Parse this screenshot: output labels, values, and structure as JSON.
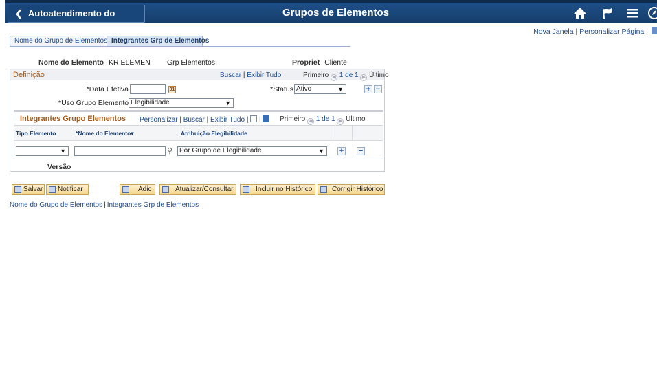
{
  "header": {
    "back_label": "Autoatendimento do Gerente",
    "title": "Grupos de Elementos",
    "icons": [
      "home-icon",
      "flag-icon",
      "menu-icon",
      "navbar-icon"
    ]
  },
  "top_links": {
    "new_window": "Nova Janela",
    "personalize": "Personalizar Página"
  },
  "tabs": [
    {
      "label": "Nome do Grupo de Elementos",
      "active": false
    },
    {
      "label": "Integrantes Grp de Elementos",
      "active": true
    }
  ],
  "summary": {
    "element_name_label": "Nome do Elemento",
    "element_name_value": "KR ELEMEN",
    "group_label": "Grp Elementos",
    "owner_label": "Propriet",
    "owner_value": "Cliente"
  },
  "definition": {
    "title": "Definição",
    "find": "Buscar",
    "view_all": "Exibir Tudo",
    "first": "Primeiro",
    "page_info": "1 de 1",
    "last": "Último",
    "effdt_label": "*Data Efetiva",
    "effdt_value": "",
    "status_label": "*Status",
    "status_value": "Ativo",
    "usage_label": "*Uso Grupo Elementos",
    "usage_value": "Elegibilidade",
    "version_label": "Versão"
  },
  "grid": {
    "title": "Integrantes Grupo Elementos",
    "personalize": "Personalizar",
    "find": "Buscar",
    "view_all": "Exibir Tudo",
    "first": "Primeiro",
    "page_info": "1 de 1",
    "last": "Último",
    "columns": [
      "Tipo Elemento",
      "*Nome do Elemento▾",
      "Atribuição Elegibilidade"
    ],
    "row": {
      "element_type": "",
      "element_name": "",
      "eligibility": "Por Grupo de Elegibilidade"
    }
  },
  "buttons": {
    "save": "Salvar",
    "notify": "Notificar",
    "add": "Adic",
    "update": "Atualizar/Consultar",
    "history": "Incluir no Histórico",
    "correct": "Corrigir Histórico"
  },
  "bottom_links": [
    "Nome do Grupo de Elementos",
    "Integrantes Grp de Elementos"
  ]
}
